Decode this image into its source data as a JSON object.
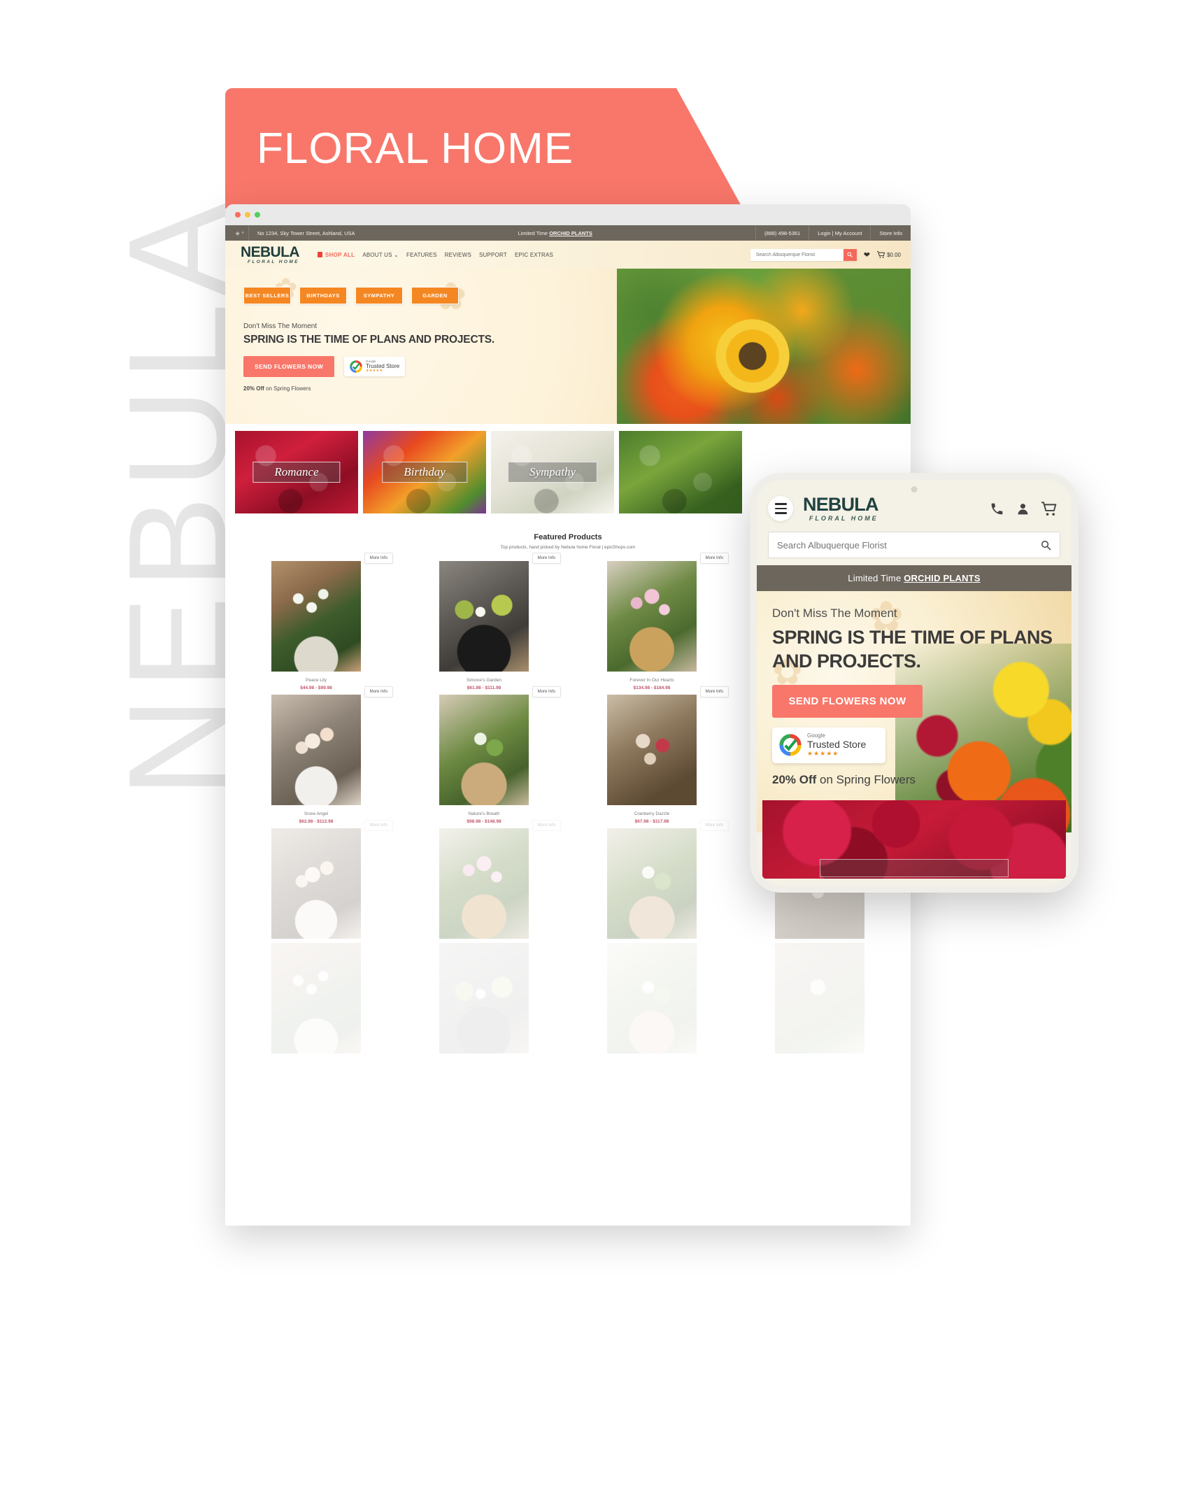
{
  "ribbon": {
    "label": "FLORAL HOME"
  },
  "watermark": {
    "text": "NEBULA"
  },
  "desktop": {
    "topbar": {
      "globe_icon": "globe-icon",
      "address": "No 1234, Sky Tower Street, Ashland, USA",
      "promo_prefix": "Limited Time ",
      "promo_link": "ORCHID PLANTS",
      "phone": "(888) 498-5361",
      "account": "Login | My Account",
      "store_info": "Store Info"
    },
    "nav": {
      "logo_main": "NEBULA",
      "logo_sub": "FLORAL HOME",
      "shop_all": "SHOP ALL",
      "links": [
        {
          "label": "ABOUT US",
          "caret": "⌄"
        },
        {
          "label": "FEATURES"
        },
        {
          "label": "REVIEWS"
        },
        {
          "label": "SUPPORT"
        },
        {
          "label": "EPIC EXTRAS"
        }
      ],
      "search_placeholder": "Search Albuquerque Florist",
      "search_icon": "search-icon",
      "wishlist_icon": "heart-icon",
      "cart_icon": "cart-icon",
      "cart_total": "$0.00"
    },
    "hero": {
      "categories": [
        "BEST SELLERS",
        "BIRTHDAYS",
        "SYMPATHY",
        "GARDEN"
      ],
      "kicker": "Don't Miss The Moment",
      "title": "SPRING IS THE TIME OF PLANS AND PROJECTS.",
      "cta": "SEND FLOWERS NOW",
      "badge_google": "Google",
      "badge_trusted": "Trusted Store",
      "badge_stars": "★★★★★",
      "offer_bold": "20% Off",
      "offer_rest": " on Spring Flowers"
    },
    "category_cards": [
      {
        "label": "Romance"
      },
      {
        "label": "Birthday"
      },
      {
        "label": "Sympathy"
      },
      {
        "label": ""
      }
    ],
    "featured": {
      "title": "Featured Products",
      "subtitle": "Top products, hand picked by Nebula home Floral | epicShops.com",
      "more_info_label": "More Info",
      "products": [
        {
          "name": "Peace Lily",
          "price": "$44.98 - $99.98"
        },
        {
          "name": "Simone's Garden",
          "price": "$61.98 - $111.98"
        },
        {
          "name": "Forever In Our Hearts",
          "price": "$134.98 - $184.98"
        },
        {
          "name": "",
          "price": ""
        },
        {
          "name": "Snow Angel",
          "price": "$62.98 - $112.98"
        },
        {
          "name": "Nature's Breath",
          "price": "$98.98 - $148.98"
        },
        {
          "name": "Cranberry Dazzle",
          "price": "$67.98 - $117.98"
        },
        {
          "name": "",
          "price": ""
        }
      ]
    }
  },
  "mobile": {
    "menu_icon": "hamburger-icon",
    "logo_main": "NEBULA",
    "logo_sub": "FLORAL HOME",
    "phone_icon": "phone-icon",
    "account_icon": "user-icon",
    "cart_icon": "cart-icon",
    "search_placeholder": "Search Albuquerque Florist",
    "search_icon": "search-icon",
    "promo_prefix": "Limited Time ",
    "promo_link": "ORCHID PLANTS",
    "kicker": "Don't Miss The Moment",
    "title": "SPRING IS THE TIME OF PLANS AND PROJECTS.",
    "cta": "SEND FLOWERS NOW",
    "badge_google": "Google",
    "badge_trusted": "Trusted Store",
    "badge_stars": "★★★★★",
    "offer_bold": "20% Off",
    "offer_rest": " on Spring Flowers"
  },
  "colors": {
    "coral": "#f8776a",
    "orange": "#f58722",
    "topbar_gray": "#6d665d",
    "logo_teal": "#214341",
    "price_rose": "#c0566a"
  }
}
